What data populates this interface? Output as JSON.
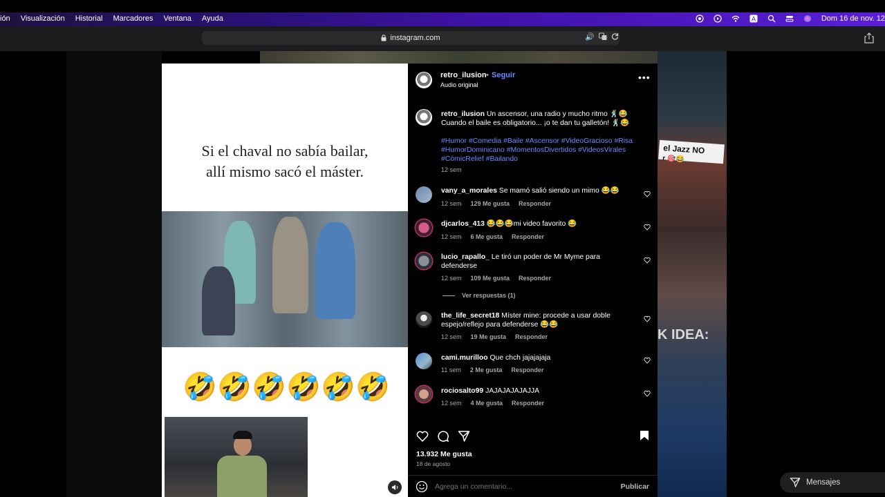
{
  "menubar": {
    "items": [
      "ión",
      "Visualización",
      "Historial",
      "Marcadores",
      "Ventana",
      "Ayuda"
    ],
    "clock": "Dom 16 de nov.  12"
  },
  "browser": {
    "url": "instagram.com"
  },
  "media": {
    "caption_line1": "Si el chaval no sabía bailar,",
    "caption_line2": "allí mismo sacó el máster.",
    "emojis": [
      "🤣",
      "🤣",
      "🤣",
      "🤣",
      "🤣",
      "🤣"
    ]
  },
  "background": {
    "tag_text": "el Jazz NO",
    "tag_sub": "r 🎯😂",
    "idea_text": "K IDEA:"
  },
  "post": {
    "username": "retro_ilusion",
    "dot": "•",
    "follow_label": "Seguir",
    "audio": "Audio original",
    "caption_user": "retro_ilusion",
    "caption_text": "Un ascensor, una radio y mucho ritmo 🕺😂 Cuando el baile es obligatorio... ¡o te dan tu galletón! 🕺😂",
    "hashtags": "#Humor #Comedia #Baile #Ascensor #VideoGracioso #Risa #HumorDominicano #MomentosDivertidos #VideosVirales #CómicRelief #Bailando",
    "caption_time": "12 sem",
    "likes": "13.932 Me gusta",
    "date": "18 de agosto",
    "comment_placeholder": "Agrega un comentario...",
    "publish_label": "Publicar"
  },
  "comments": [
    {
      "user": "vany_a_morales",
      "text": "Se mamó salió siendo un mimo 😂😂",
      "time": "12 sem",
      "likes": "129 Me gusta",
      "reply": "Responder"
    },
    {
      "user": "djcarlos_413",
      "text": "😂😂😂mi video favorito 😂",
      "time": "12 sem",
      "likes": "6 Me gusta",
      "reply": "Responder"
    },
    {
      "user": "lucio_rapallo_",
      "text": "Le tiró un poder de Mr Myme para defenderse",
      "time": "12 sem",
      "likes": "109 Me gusta",
      "reply": "Responder",
      "view_replies": "Ver respuestas (1)"
    },
    {
      "user": "the_life_secret18",
      "text": "Míster mine: procede a usar doble espejo/reflejo para defenderse 😂😂",
      "time": "12 sem",
      "likes": "19 Me gusta",
      "reply": "Responder"
    },
    {
      "user": "cami.murilloo",
      "text": "Que chch jajajajaja",
      "time": "11 sem",
      "likes": "2 Me gusta",
      "reply": "Responder"
    },
    {
      "user": "rociosalto99",
      "text": "JAJAJAJAJAJJA",
      "time": "12 sem",
      "likes": "4 Me gusta",
      "reply": "Responder"
    }
  ],
  "messages": {
    "label": "Mensajes"
  },
  "colors": {
    "link": "#6c8cff",
    "panel_bg": "#000000",
    "menubar_accent": "#3f12a8"
  }
}
